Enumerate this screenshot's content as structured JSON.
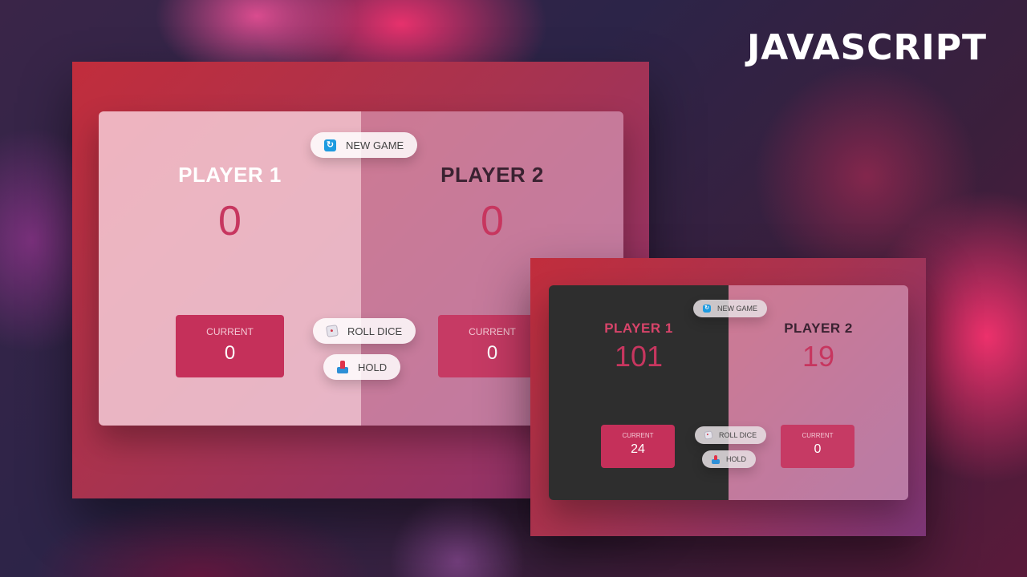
{
  "brand": {
    "title": "JAVASCRIPT"
  },
  "screens": [
    {
      "id": "start-state",
      "players": [
        {
          "name": "PLAYER 1",
          "score": "0",
          "current_label": "CURRENT",
          "current_value": "0",
          "active": true
        },
        {
          "name": "PLAYER 2",
          "score": "0",
          "current_label": "CURRENT",
          "current_value": "0",
          "active": false
        }
      ],
      "buttons": {
        "new_game": {
          "label": "NEW GAME",
          "icon": "refresh-icon"
        },
        "roll_dice": {
          "label": "ROLL DICE",
          "icon": "dice-icon"
        },
        "hold": {
          "label": "HOLD",
          "icon": "download-inbox-icon"
        }
      }
    },
    {
      "id": "winner-state",
      "players": [
        {
          "name": "PLAYER 1",
          "score": "101",
          "current_label": "CURRENT",
          "current_value": "24",
          "winner": true
        },
        {
          "name": "PLAYER 2",
          "score": "19",
          "current_label": "CURRENT",
          "current_value": "0",
          "winner": false
        }
      ],
      "buttons": {
        "new_game": {
          "label": "NEW GAME",
          "icon": "refresh-icon"
        },
        "roll_dice": {
          "label": "ROLL DICE",
          "icon": "dice-icon"
        },
        "hold": {
          "label": "HOLD",
          "icon": "download-inbox-icon"
        }
      }
    }
  ],
  "colors": {
    "accent": "#c7365f",
    "winner_panel": "#2e2e2e",
    "current_box": "#c5305a",
    "new_game_icon": "#1e9be0"
  }
}
